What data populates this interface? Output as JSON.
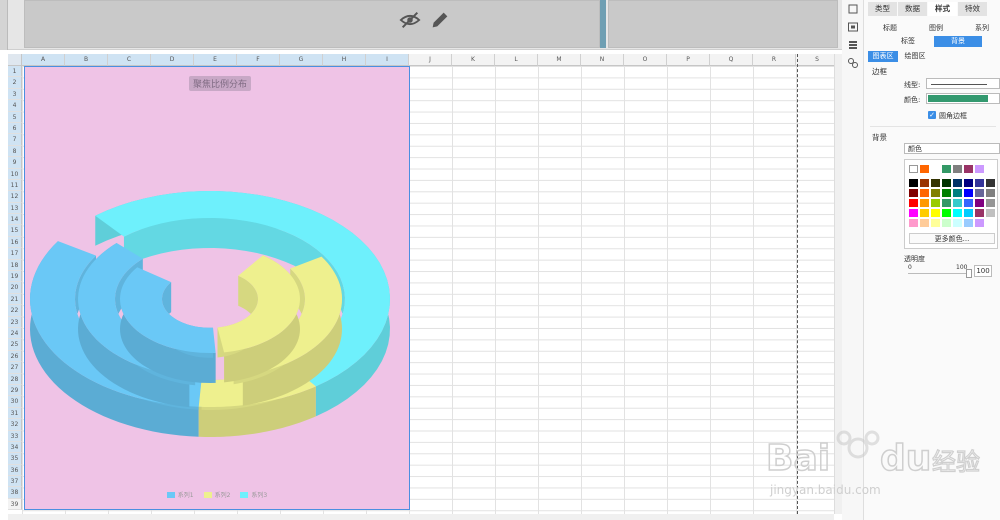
{
  "properties_panel": {
    "tabs": [
      "类型",
      "数据",
      "样式",
      "特效"
    ],
    "subtabs_row1": [
      "标题",
      "图例",
      "系列"
    ],
    "subtabs_row2": [
      "标签",
      "背景"
    ],
    "area_tabs": [
      "图表区",
      "绘图区"
    ],
    "border_section": "边框",
    "linetype_label": "线型:",
    "color_label": "颜色:",
    "border_color": "#33996f",
    "rounded_border_label": "圆角边框",
    "background_section": "背景",
    "background_type": "颜色",
    "more_colors": "更多颜色...",
    "opacity_label": "透明度",
    "slider_min": "0",
    "slider_max": "100",
    "opacity_value": "100"
  },
  "spreadsheet": {
    "columns": [
      "A",
      "B",
      "C",
      "D",
      "E",
      "F",
      "G",
      "H",
      "I",
      "J",
      "K",
      "L",
      "M",
      "N",
      "O",
      "P",
      "Q",
      "R",
      "S"
    ],
    "rows": [
      "1",
      "2",
      "3",
      "4",
      "5",
      "6",
      "7",
      "8",
      "9",
      "10",
      "11",
      "12",
      "13",
      "14",
      "15",
      "16",
      "17",
      "18",
      "19",
      "20",
      "21",
      "22",
      "23",
      "24",
      "25",
      "26",
      "27",
      "28",
      "29",
      "30",
      "31",
      "32",
      "33",
      "34",
      "35",
      "36",
      "37",
      "38",
      "39"
    ]
  },
  "chart": {
    "title": "聚焦比例分布",
    "background_color": "#efc3e6",
    "series": [
      {
        "name": "系列1",
        "color": "#6ac8f6"
      },
      {
        "name": "系列2",
        "color": "#eef08e"
      },
      {
        "name": "系列3",
        "color": "#6ef0fc"
      }
    ]
  },
  "watermark": {
    "brand": "Bai",
    "brand2": "du",
    "brand3": "经验",
    "url": "jingyan.baidu.com"
  }
}
